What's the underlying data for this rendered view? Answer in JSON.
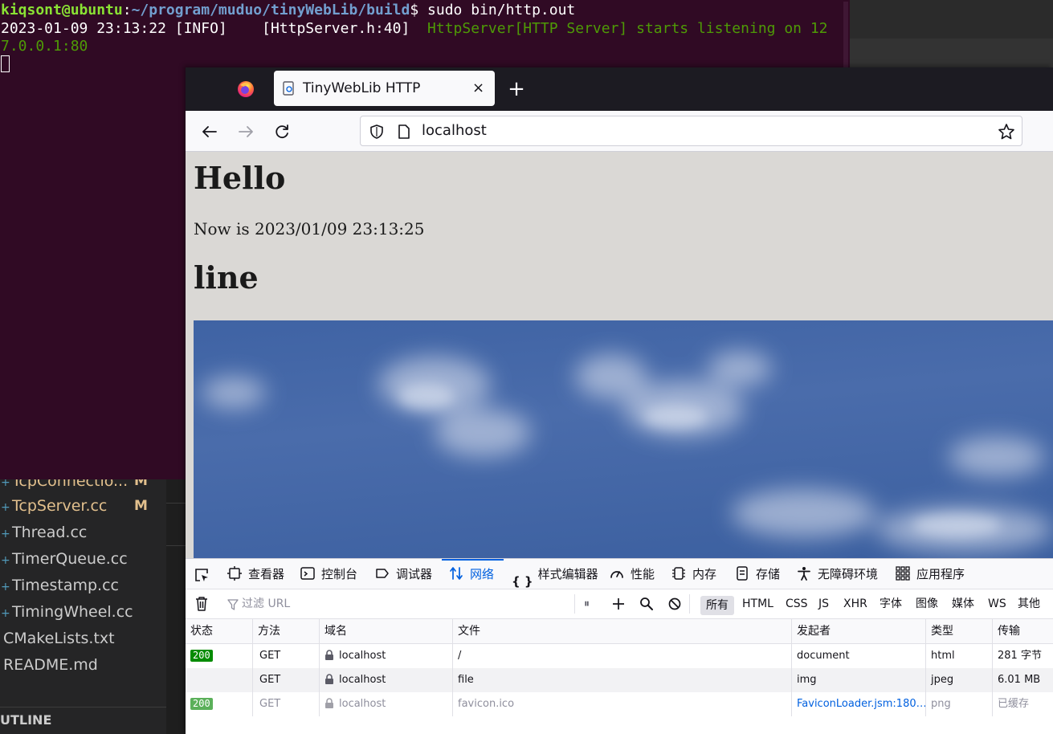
{
  "terminal": {
    "prompt_user": "kiqsont@ubuntu",
    "prompt_sep": ":",
    "prompt_path": "~/program/muduo/tinyWebLib/build",
    "prompt_dollar": "$ ",
    "command": "sudo bin/http.out",
    "log_prefix": "2023-01-09 23:13:22 [INFO]    [HttpServer.h:40]  ",
    "log_message_line1": "HttpServer[HTTP Server] starts listening on 12",
    "log_message_line2": "7.0.0.1:80"
  },
  "explorer": {
    "files": [
      {
        "name": "TcpConnectio...",
        "badge": "M",
        "modified": true
      },
      {
        "name": "TcpServer.cc",
        "badge": "M",
        "modified": true
      },
      {
        "name": "Thread.cc",
        "badge": "",
        "modified": false
      },
      {
        "name": "TimerQueue.cc",
        "badge": "",
        "modified": false
      },
      {
        "name": "Timestamp.cc",
        "badge": "",
        "modified": false
      },
      {
        "name": "TimingWheel.cc",
        "badge": "",
        "modified": false
      },
      {
        "name": "CMakeLists.txt",
        "badge": "",
        "modified": false
      },
      {
        "name": "README.md",
        "badge": "",
        "modified": false
      }
    ],
    "outline_label": "UTLINE"
  },
  "browser": {
    "tab_title": "TinyWebLib HTTP",
    "tab_close": "×",
    "new_tab": "+",
    "url": "localhost"
  },
  "page": {
    "heading1": "Hello",
    "now_text": "Now is 2023/01/09 23:13:25",
    "heading2": "line"
  },
  "devtools": {
    "tabs": [
      "查看器",
      "控制台",
      "调试器",
      "网络",
      "样式编辑器",
      "性能",
      "内存",
      "存储",
      "无障碍环境",
      "应用程序"
    ],
    "active_tab": "网络",
    "filter_placeholder": "过滤 URL",
    "pause_glyph": "⏸",
    "type_filters": [
      "所有",
      "HTML",
      "CSS",
      "JS",
      "XHR",
      "字体",
      "图像",
      "媒体",
      "WS",
      "其他"
    ],
    "columns": [
      "状态",
      "方法",
      "域名",
      "文件",
      "发起者",
      "类型",
      "传输"
    ],
    "rows": [
      {
        "status": "200",
        "method": "GET",
        "domain": "localhost",
        "file": "/",
        "initiator": "document",
        "type": "html",
        "transfer": "281 字节"
      },
      {
        "status": "",
        "method": "GET",
        "domain": "localhost",
        "file": "file",
        "initiator": "img",
        "type": "jpeg",
        "transfer": "6.01 MB"
      },
      {
        "status": "200",
        "method": "GET",
        "domain": "localhost",
        "file": "favicon.ico",
        "initiator": "FaviconLoader.jsm:180…",
        "type": "png",
        "transfer": "已缓存"
      }
    ]
  },
  "colors": {
    "terminal_bg": "#300a24",
    "firefox_tabbar": "#1c1b22",
    "devtools_accent": "#0060df",
    "status_ok": "#058b00"
  }
}
